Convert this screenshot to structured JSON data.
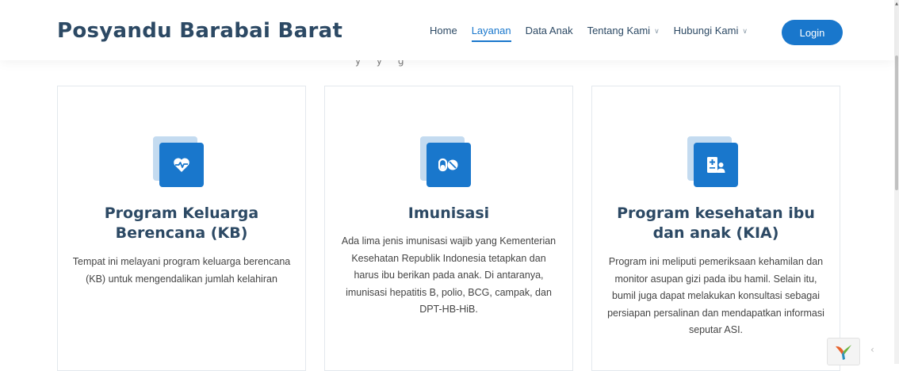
{
  "page": {
    "top_fragment": "~ (~~)",
    "subtitle_fragment": "y                    y      g"
  },
  "header": {
    "logo": "Posyandu Barabai Barat",
    "nav": [
      {
        "label": "Home",
        "active": false,
        "dropdown": false
      },
      {
        "label": "Layanan",
        "active": true,
        "dropdown": false
      },
      {
        "label": "Data Anak",
        "active": false,
        "dropdown": false
      },
      {
        "label": "Tentang Kami",
        "active": false,
        "dropdown": true
      },
      {
        "label": "Hubungi Kami",
        "active": false,
        "dropdown": true
      }
    ],
    "login_label": "Login"
  },
  "services": [
    {
      "icon": "heartbeat-icon",
      "title": "Program Keluarga Berencana (KB)",
      "description": "Tempat ini melayani program keluarga berencana (KB) untuk mengendalikan jumlah kelahiran"
    },
    {
      "icon": "pills-icon",
      "title": "Imunisasi",
      "description": "Ada lima jenis imunisasi wajib yang Kementerian Kesehatan Republik Indonesia tetapkan dan harus ibu berikan pada anak. Di antaranya, imunisasi hepatitis B, polio, BCG, campak, dan DPT-HB-HiB."
    },
    {
      "icon": "user-medical-icon",
      "title": "Program kesehatan ibu dan anak (KIA)",
      "description": "Program ini meliputi pemeriksaan kehamilan dan monitor asupan gizi pada ibu hamil. Selain itu, bumil juga dapat melakukan konsultasi sebagai persiapan persalinan dan mendapatkan informasi seputar ASI."
    }
  ],
  "colors": {
    "brand": "#2c4964",
    "accent": "#1977cc",
    "icon_back": "#c4dbf0"
  }
}
